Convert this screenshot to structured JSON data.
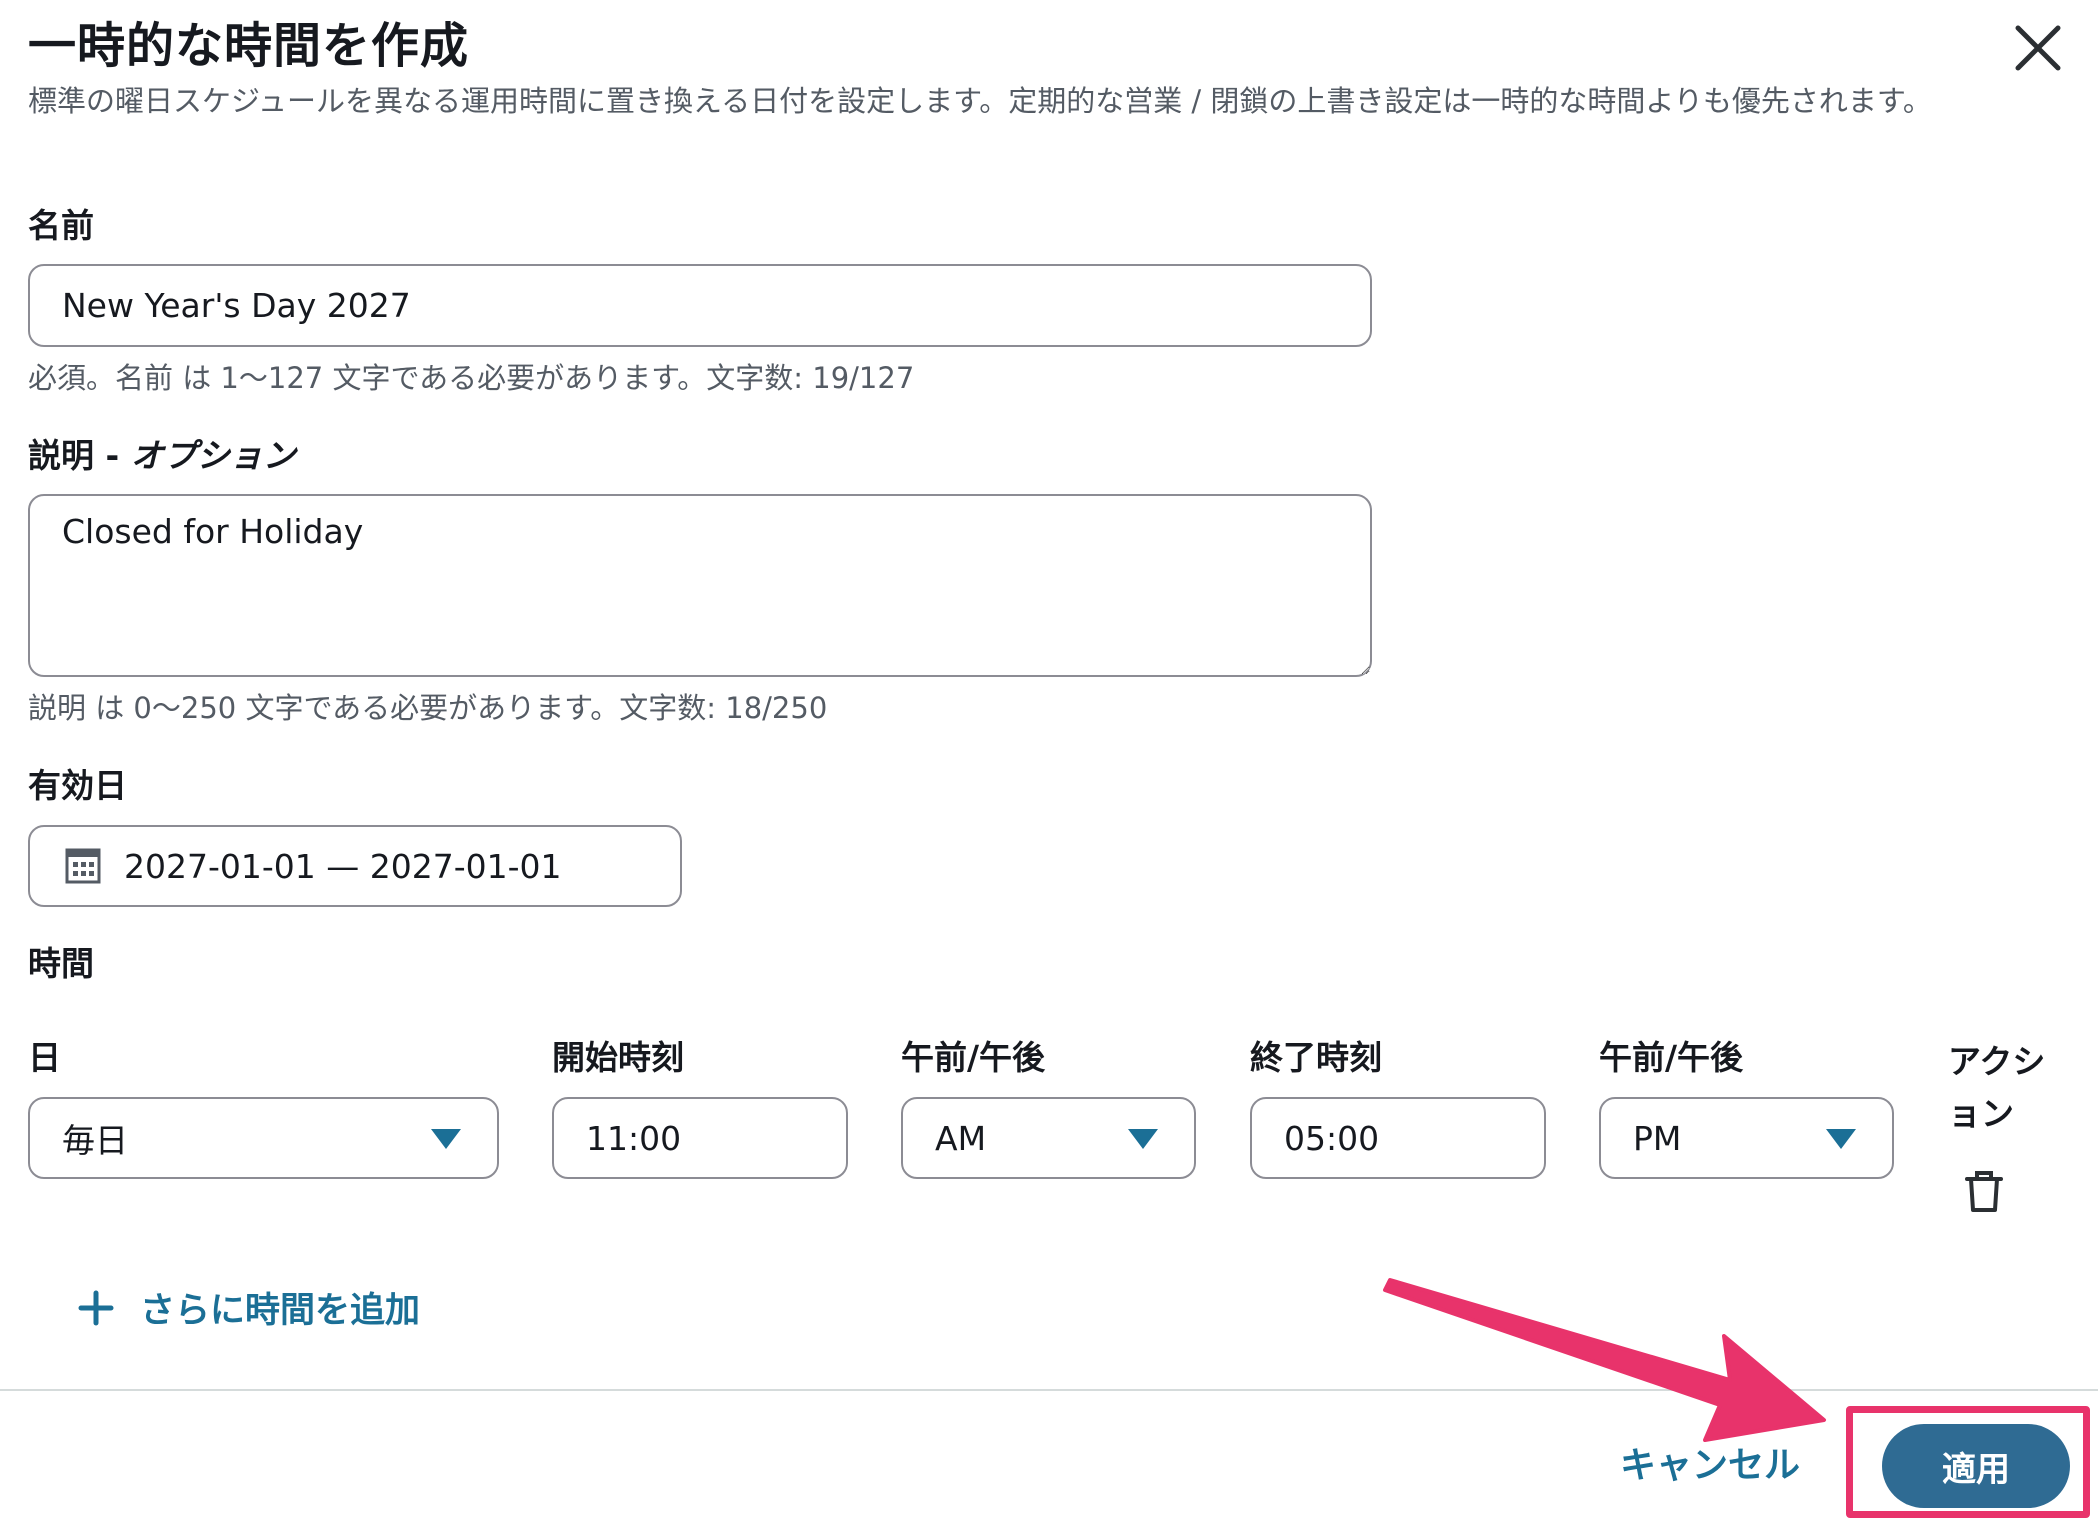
{
  "modal": {
    "title": "一時的な時間を作成",
    "description": "標準の曜日スケジュールを異なる運用時間に置き換える日付を設定します。定期的な営業 / 閉鎖の上書き設定は一時的な時間よりも優先されます。"
  },
  "name_field": {
    "label": "名前",
    "value": "New Year's Day 2027",
    "hint": "必須。名前 は 1〜127 文字である必要があります。文字数: 19/127"
  },
  "description_field": {
    "label": "説明 - ",
    "label_optional": "オプション",
    "value": "Closed for Holiday",
    "hint": "説明 は 0〜250 文字である必要があります。文字数: 18/250"
  },
  "effective_date": {
    "label": "有効日",
    "value": "2027-01-01 — 2027-01-01"
  },
  "hours": {
    "section_label": "時間",
    "columns": {
      "day": "日",
      "start_time": "開始時刻",
      "start_ampm": "午前/午後",
      "end_time": "終了時刻",
      "end_ampm": "午前/午後",
      "actions": "アクション"
    },
    "row": {
      "day": "毎日",
      "start_time": "11:00",
      "start_ampm": "AM",
      "end_time": "05:00",
      "end_ampm": "PM"
    },
    "add_more_label": "さらに時間を追加"
  },
  "footer": {
    "cancel_label": "キャンセル",
    "apply_label": "適用"
  },
  "colors": {
    "link": "#1b6f96",
    "primary_button": "#2f6b93",
    "annotation": "#e8336b"
  }
}
